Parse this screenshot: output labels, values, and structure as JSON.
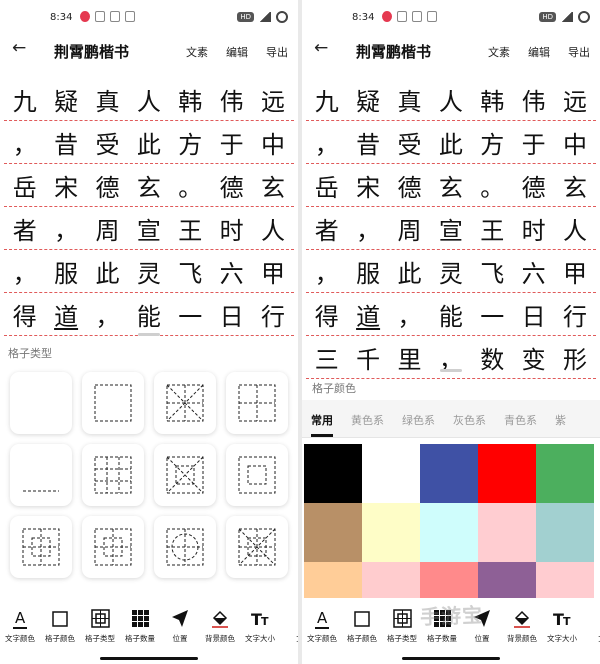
{
  "status": {
    "time": "8:34",
    "hd": "HD"
  },
  "app": {
    "title": "荆霄鹏楷书",
    "actions": [
      "文素",
      "编辑",
      "导出"
    ],
    "back_icon": "arrow-left-icon"
  },
  "left_rows": [
    [
      "九",
      "疑",
      "真",
      "人",
      "韩",
      "伟",
      "远"
    ],
    [
      "，",
      "昔",
      "受",
      "此",
      "方",
      "于",
      "中"
    ],
    [
      "岳",
      "宋",
      "德",
      "玄",
      "。",
      "德",
      "玄"
    ],
    [
      "者",
      "，",
      "周",
      "宣",
      "王",
      "时",
      "人"
    ],
    [
      "，",
      "服",
      "此",
      "灵",
      "飞",
      "六",
      "甲"
    ],
    [
      "得",
      "道",
      "，",
      "能",
      "一",
      "日",
      "行"
    ]
  ],
  "right_extra_row": [
    "三",
    "千",
    "里",
    "，",
    "数",
    "变",
    "形"
  ],
  "left_section_label": "格子类型",
  "right_section_label": "格子颜色",
  "color_tabs": [
    "常用",
    "黄色系",
    "绿色系",
    "灰色系",
    "青色系",
    "紫"
  ],
  "swatch_colors": [
    "#000000",
    "#ffffff",
    "#3f51a5",
    "#ff0000",
    "#4caf5e",
    "#b89067",
    "#fefdc7",
    "#cffdfc",
    "#ffcdd1",
    "#a2d0d0",
    "#ffcd98",
    "#ffccce",
    "#ff8a8b",
    "#8e6096",
    "#ffccd0"
  ],
  "toolbar": [
    {
      "label": "文字颜色",
      "icon": "text-color-icon"
    },
    {
      "label": "格子颜色",
      "icon": "square-icon"
    },
    {
      "label": "格子类型",
      "icon": "grid-type-icon"
    },
    {
      "label": "格子数量",
      "icon": "grid-count-icon"
    },
    {
      "label": "位置",
      "icon": "position-icon"
    },
    {
      "label": "背景颜色",
      "icon": "fill-icon"
    },
    {
      "label": "文字大小",
      "icon": "text-size-icon"
    },
    {
      "label": "文",
      "icon": "more-icon"
    }
  ],
  "watermark": "手游宝",
  "accent": {
    "rule": "#e05a5a",
    "underline_tab": "#111111"
  }
}
